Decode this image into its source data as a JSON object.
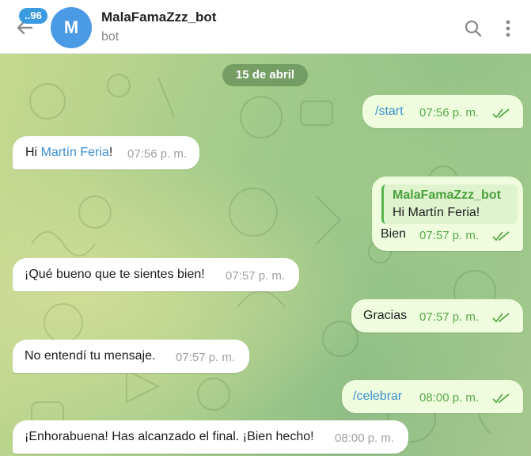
{
  "header": {
    "unread_count": "..96",
    "avatar_letter": "M",
    "title": "MalaFamaZzz_bot",
    "subtitle": "bot",
    "back_icon": "arrow-left-icon",
    "search_icon": "search-icon",
    "menu_icon": "vertical-dots-icon"
  },
  "chat": {
    "date_separator": "15 de abril",
    "messages": [
      {
        "direction": "out",
        "text": "/start",
        "time": "07:56 p. m.",
        "status": "read"
      },
      {
        "direction": "in",
        "text_before": "Hi ",
        "mention": "Martín Feria",
        "text_after": "!",
        "time": "07:56 p. m."
      },
      {
        "direction": "out",
        "reply_author": "MalaFamaZzz_bot",
        "reply_text": "Hi Martín Feria!",
        "text": "Bien",
        "time": "07:57 p. m.",
        "status": "read"
      },
      {
        "direction": "in",
        "text": "¡Qué bueno que te sientes bien!",
        "time": "07:57 p. m."
      },
      {
        "direction": "out",
        "text": "Gracias",
        "time": "07:57 p. m.",
        "status": "read"
      },
      {
        "direction": "in",
        "text": "No entendí tu mensaje.",
        "time": "07:57 p. m."
      },
      {
        "direction": "out",
        "text": "/celebrar",
        "time": "08:00 p. m.",
        "status": "read"
      },
      {
        "direction": "in",
        "text": "¡Enhorabuena! Has alcanzado el final. ¡Bien hecho!",
        "time": "08:00 p. m."
      }
    ]
  },
  "colors": {
    "accent": "#3a9be0",
    "outgoing_bubble": "#effdde",
    "incoming_bubble": "#ffffff",
    "read_check": "#5aa84c"
  }
}
